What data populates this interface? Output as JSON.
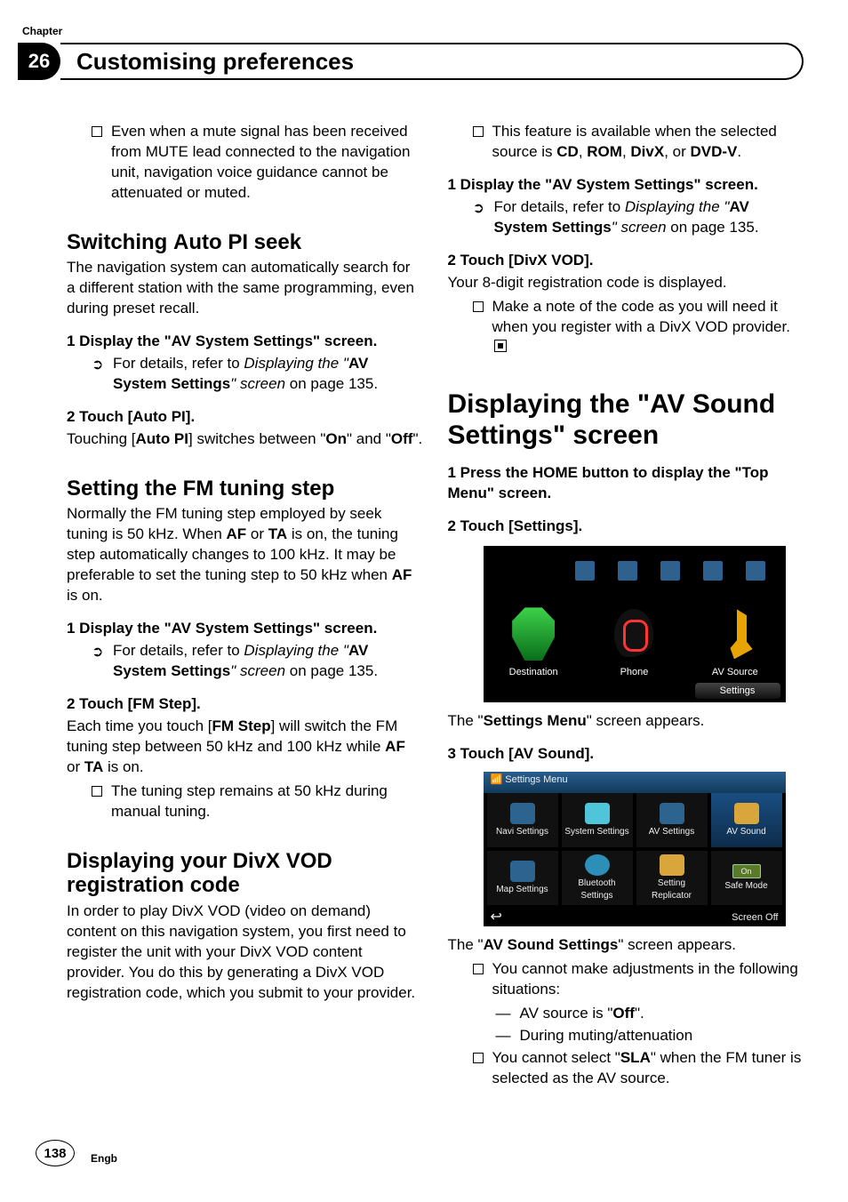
{
  "chapter": {
    "label": "Chapter",
    "number": "26",
    "title": "Customising preferences"
  },
  "left": {
    "intro_bullet": "Even when a mute signal has been received from MUTE lead connected to the navigation unit, navigation voice guidance cannot be attenuated or muted.",
    "h_switch_pre": "Switching ",
    "h_switch_em": "Auto PI",
    "h_switch_post": " seek",
    "switch_intro": "The navigation system can automatically search for a different station with the same programming, even during preset recall.",
    "step1": "1    Display the \"AV System Settings\" screen.",
    "details_pre": "For details, refer to ",
    "details_i": "Displaying the \"",
    "details_b": "AV System Settings",
    "details_post": "\" screen",
    "details_page": " on page 135.",
    "step2": "2    Touch [Auto PI].",
    "step2_body_a": "Touching [",
    "step2_body_b": "Auto PI",
    "step2_body_c": "] switches between \"",
    "step2_body_d": "On",
    "step2_body_e": "\" and \"",
    "step2_body_f": "Off",
    "step2_body_g": "\".",
    "h_fm": "Setting the FM tuning step",
    "fm_intro_a": "Normally the FM tuning step employed by seek tuning is 50 kHz. When ",
    "fm_intro_af": "AF",
    "fm_intro_or": " or ",
    "fm_intro_ta": "TA",
    "fm_intro_b": " is on, the tuning step automatically changes to 100 kHz. It may be preferable to set the tuning step to 50 kHz when ",
    "fm_intro_c": " is on.",
    "fm_step1": "1    Display the \"AV System Settings\" screen.",
    "fm_step2": "2    Touch [FM Step].",
    "fm_body_a": "Each time you touch [",
    "fm_body_b": "FM Step",
    "fm_body_c": "] will switch the FM tuning step between 50 kHz and 100 kHz while ",
    "fm_body_af": "AF",
    "fm_body_or": " or ",
    "fm_body_ta": "TA",
    "fm_body_d": " is on.",
    "fm_bullet": "The tuning step remains at 50 kHz during manual tuning.",
    "h_divx": "Displaying your DivX VOD registration code",
    "divx_body": "In order to play DivX VOD (video on demand) content on this navigation system, you first need to register the unit with your DivX VOD content provider. You do this by generating a DivX VOD registration code, which you submit to your provider."
  },
  "right": {
    "bullet1_a": "This feature is available when the selected source is ",
    "bullet1_cd": "CD",
    "bullet1_c1": ", ",
    "bullet1_rom": "ROM",
    "bullet1_c2": ", ",
    "bullet1_divx": "DivX",
    "bullet1_c3": ", or ",
    "bullet1_dvdv": "DVD-V",
    "bullet1_end": ".",
    "step1": "1    Display the \"AV System Settings\" screen.",
    "step2": "2    Touch [DivX VOD].",
    "step2_body": "Your 8-digit registration code is displayed.",
    "step2_bullet": "Make a note of the code as you will need it when you register with a DivX VOD provider.",
    "h_big_a": "Displaying the \"",
    "h_big_b": "AV Sound Settings",
    "h_big_c": "\" screen",
    "s_step1": "1    Press the HOME button to display the \"Top Menu\" screen.",
    "s_step2": "2    Touch [Settings].",
    "ui1": {
      "dest": "Destination",
      "phone": "Phone",
      "av": "AV Source",
      "settings": "Settings"
    },
    "after_ui1_a": "The \"",
    "after_ui1_b": "Settings Menu",
    "after_ui1_c": "\" screen appears.",
    "s_step3": "3    Touch [AV Sound].",
    "ui2": {
      "title": "Settings Menu",
      "c1": "Navi Settings",
      "c2": "System Settings",
      "c3": "AV Settings",
      "c4": "AV Sound",
      "c5": "Map Settings",
      "c6": "Bluetooth Settings",
      "c7": "Setting Replicator",
      "c8": "Safe Mode",
      "on": "On",
      "back": "↩",
      "screenoff": "Screen Off"
    },
    "after_ui2_a": "The \"",
    "after_ui2_b": "AV Sound Settings",
    "after_ui2_c": "\" screen appears.",
    "b1": "You cannot make adjustments in the following situations:",
    "d1_a": "AV source is \"",
    "d1_b": "Off",
    "d1_c": "\".",
    "d2": "During muting/attenuation",
    "b2_a": "You cannot select \"",
    "b2_b": "SLA",
    "b2_c": "\" when the FM tuner is selected as the AV source."
  },
  "footer": {
    "page": "138",
    "lang": "Engb"
  }
}
